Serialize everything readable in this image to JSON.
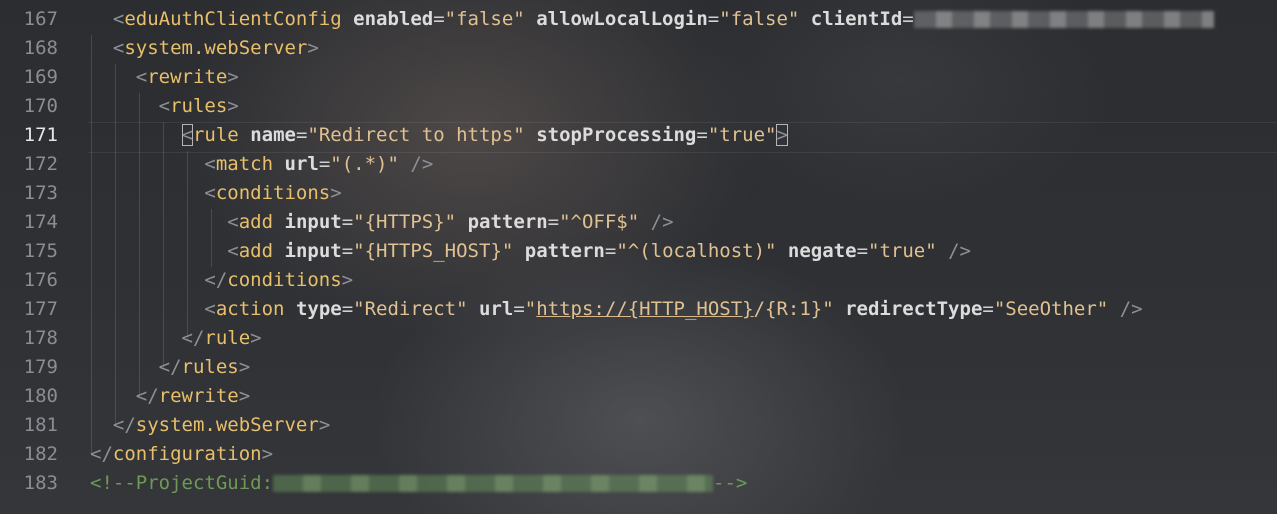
{
  "editor": {
    "lines": [
      {
        "num": "167",
        "indent": "  ",
        "parts": [
          [
            "p",
            "<"
          ],
          [
            "t",
            "eduAuthClientConfig"
          ],
          [
            "s",
            " "
          ],
          [
            "a",
            "enabled"
          ],
          [
            "eq",
            "="
          ],
          [
            "v",
            "\"false\""
          ],
          [
            "s",
            " "
          ],
          [
            "a",
            "allowLocalLogin"
          ],
          [
            "eq",
            "="
          ],
          [
            "v",
            "\"false\""
          ],
          [
            "s",
            " "
          ],
          [
            "a",
            "clientId"
          ],
          [
            "eq",
            "="
          ]
        ],
        "redacted": "grey"
      },
      {
        "num": "168",
        "indent": "  ",
        "parts": [
          [
            "p",
            "<"
          ],
          [
            "t",
            "system.webServer"
          ],
          [
            "p",
            ">"
          ]
        ]
      },
      {
        "num": "169",
        "indent": "    ",
        "parts": [
          [
            "p",
            "<"
          ],
          [
            "t",
            "rewrite"
          ],
          [
            "p",
            ">"
          ]
        ]
      },
      {
        "num": "170",
        "indent": "      ",
        "parts": [
          [
            "p",
            "<"
          ],
          [
            "t",
            "rules"
          ],
          [
            "p",
            ">"
          ]
        ]
      },
      {
        "num": "171",
        "indent": "        ",
        "active": true,
        "parts": [
          [
            "pb",
            "<"
          ],
          [
            "t",
            "rule"
          ],
          [
            "s",
            " "
          ],
          [
            "a",
            "name"
          ],
          [
            "eq",
            "="
          ],
          [
            "v",
            "\"Redirect to https\""
          ],
          [
            "s",
            " "
          ],
          [
            "a",
            "stopProcessing"
          ],
          [
            "eq",
            "="
          ],
          [
            "v",
            "\"true\""
          ],
          [
            "pb",
            ">"
          ]
        ]
      },
      {
        "num": "172",
        "indent": "          ",
        "parts": [
          [
            "p",
            "<"
          ],
          [
            "t",
            "match"
          ],
          [
            "s",
            " "
          ],
          [
            "a",
            "url"
          ],
          [
            "eq",
            "="
          ],
          [
            "v",
            "\"(.*)\""
          ],
          [
            "s",
            " "
          ],
          [
            "p",
            "/>"
          ]
        ]
      },
      {
        "num": "173",
        "indent": "          ",
        "parts": [
          [
            "p",
            "<"
          ],
          [
            "t",
            "conditions"
          ],
          [
            "p",
            ">"
          ]
        ]
      },
      {
        "num": "174",
        "indent": "            ",
        "parts": [
          [
            "p",
            "<"
          ],
          [
            "t",
            "add"
          ],
          [
            "s",
            " "
          ],
          [
            "a",
            "input"
          ],
          [
            "eq",
            "="
          ],
          [
            "v",
            "\"{HTTPS}\""
          ],
          [
            "s",
            " "
          ],
          [
            "a",
            "pattern"
          ],
          [
            "eq",
            "="
          ],
          [
            "v",
            "\"^OFF$\""
          ],
          [
            "s",
            " "
          ],
          [
            "p",
            "/>"
          ]
        ]
      },
      {
        "num": "175",
        "indent": "            ",
        "parts": [
          [
            "p",
            "<"
          ],
          [
            "t",
            "add"
          ],
          [
            "s",
            " "
          ],
          [
            "a",
            "input"
          ],
          [
            "eq",
            "="
          ],
          [
            "v",
            "\"{HTTPS_HOST}\""
          ],
          [
            "s",
            " "
          ],
          [
            "a",
            "pattern"
          ],
          [
            "eq",
            "="
          ],
          [
            "v",
            "\"^(localhost)\""
          ],
          [
            "s",
            " "
          ],
          [
            "a",
            "negate"
          ],
          [
            "eq",
            "="
          ],
          [
            "v",
            "\"true\""
          ],
          [
            "s",
            " "
          ],
          [
            "p",
            "/>"
          ]
        ]
      },
      {
        "num": "176",
        "indent": "          ",
        "parts": [
          [
            "p",
            "</"
          ],
          [
            "t",
            "conditions"
          ],
          [
            "p",
            ">"
          ]
        ]
      },
      {
        "num": "177",
        "indent": "          ",
        "parts": [
          [
            "p",
            "<"
          ],
          [
            "t",
            "action"
          ],
          [
            "s",
            " "
          ],
          [
            "a",
            "type"
          ],
          [
            "eq",
            "="
          ],
          [
            "v",
            "\"Redirect\""
          ],
          [
            "s",
            " "
          ],
          [
            "a",
            "url"
          ],
          [
            "eq",
            "="
          ],
          [
            "v",
            "\""
          ],
          [
            "vu",
            "https://{HTTP_HOST}"
          ],
          [
            "v",
            "/{R:1}\""
          ],
          [
            "s",
            " "
          ],
          [
            "a",
            "redirectType"
          ],
          [
            "eq",
            "="
          ],
          [
            "v",
            "\"SeeOther\""
          ],
          [
            "s",
            " "
          ],
          [
            "p",
            "/>"
          ]
        ]
      },
      {
        "num": "178",
        "indent": "        ",
        "parts": [
          [
            "p",
            "</"
          ],
          [
            "t",
            "rule"
          ],
          [
            "p",
            ">"
          ]
        ]
      },
      {
        "num": "179",
        "indent": "      ",
        "parts": [
          [
            "p",
            "</"
          ],
          [
            "t",
            "rules"
          ],
          [
            "p",
            ">"
          ]
        ]
      },
      {
        "num": "180",
        "indent": "    ",
        "parts": [
          [
            "p",
            "</"
          ],
          [
            "t",
            "rewrite"
          ],
          [
            "p",
            ">"
          ]
        ]
      },
      {
        "num": "181",
        "indent": "  ",
        "parts": [
          [
            "p",
            "</"
          ],
          [
            "t",
            "system.webServer"
          ],
          [
            "p",
            ">"
          ]
        ]
      },
      {
        "num": "182",
        "indent": "",
        "parts": [
          [
            "p",
            "</"
          ],
          [
            "t",
            "configuration"
          ],
          [
            "p",
            ">"
          ]
        ]
      },
      {
        "num": "183",
        "indent": "",
        "parts": [
          [
            "cm",
            "<!--ProjectGuid:"
          ]
        ],
        "redacted": "green",
        "tail": [
          "cm",
          "-->"
        ]
      }
    ]
  },
  "colors": {
    "tag": "#e8bf6a",
    "attribute": "#dcdcdc",
    "value": "#e0c191",
    "punctuation": "#8d9096",
    "comment": "#6e9a55",
    "line_number": "#8a8d93"
  }
}
